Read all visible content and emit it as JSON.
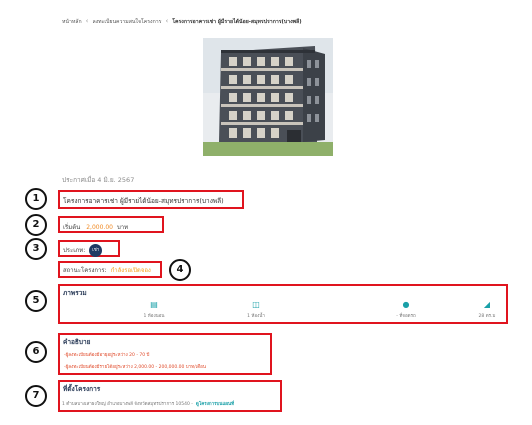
{
  "breadcrumb": {
    "home": "หน้าหลัก",
    "list": "ลงทะเบียนความสนใจโครงการ",
    "current": "โครงการอาคารเช่า ผู้มีรายได้น้อย-สมุทรปราการ(บางพลี)"
  },
  "published": "ประกาศเมื่อ 4 มิ.ย. 2567",
  "project": {
    "title": "โครงการอาคารเช่า ผู้มีรายได้น้อย-สมุทรปราการ(บางพลี)",
    "price_label": "เริ่มต้น",
    "price_value": "2,000.00",
    "price_unit": "บาท",
    "type_label": "ประเภท:",
    "type_value": "เช่า",
    "status_label": "สถานะโครงการ:",
    "status_value": "กำลังรอเปิดจอง"
  },
  "overview": {
    "heading": "ภาพรวม",
    "features": [
      {
        "icon": "bed-icon",
        "label": "1 ห้องนอน"
      },
      {
        "icon": "bathtub-icon",
        "label": "1 ห้องน้ำ"
      },
      {
        "icon": "car-icon",
        "label": "- ที่จอดรถ"
      },
      {
        "icon": "area-icon",
        "label": "28 ตร.ม"
      }
    ]
  },
  "description": {
    "heading": "คำอธิบาย",
    "lines": [
      "-ผู้ลงทะเบียนต้องมีอายุอยู่ระหว่าง 20 - 70 ปี",
      "-ผู้ลงทะเบียนต้องมีรายได้อยู่ระหว่าง 2,000.00 - 200,000.00 บาท/เดือน"
    ]
  },
  "location": {
    "heading": "ที่ตั้งโครงการ",
    "address": "1 ตำบลบางเสาธงใหญ่ อำเภอบางพลี จังหวัดสมุทรปราการ 10540 -",
    "map_link": "ดูโครงการบนแผนที่"
  },
  "annotations": [
    "1",
    "2",
    "3",
    "4",
    "5",
    "6",
    "7"
  ],
  "colors": {
    "highlight_box": "#e0141e",
    "price": "#f08a24",
    "status": "#f6a21e",
    "heading": "#2a3b58",
    "accent": "#1aa0a8",
    "type_pill": "#1f3a64"
  }
}
